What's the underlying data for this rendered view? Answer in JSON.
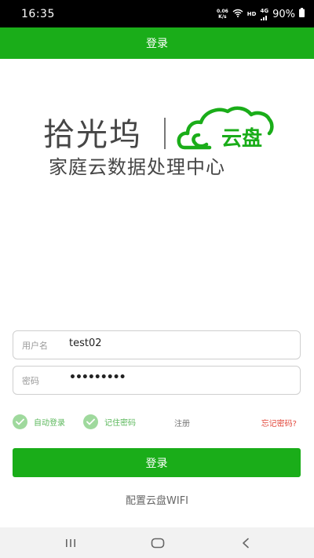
{
  "status_bar": {
    "time": "16:35",
    "speed_value": "0.06",
    "speed_unit": "K/s",
    "hd": "HD",
    "network": "4G",
    "battery": "90%"
  },
  "header": {
    "title": "登录"
  },
  "logo": {
    "brand": "拾光坞",
    "product": "云盘",
    "slogan": "家庭云数据处理中心"
  },
  "form": {
    "username_label": "用户名",
    "username_value": "test02",
    "password_label": "密码",
    "password_value": "•••••••••"
  },
  "options": {
    "auto_login": "自动登录",
    "auto_login_checked": true,
    "remember_password": "记住密码",
    "remember_password_checked": true,
    "register": "注册",
    "forgot_password": "忘记密码?"
  },
  "login_button": "登录",
  "wifi_link": "配置云盘WIFI",
  "colors": {
    "brand_green": "#1aad19",
    "check_green": "#9fd99d",
    "forgot_red": "#e2473b"
  },
  "icons": {
    "wifi": "wifi-icon",
    "battery": "battery-icon",
    "check": "check-icon",
    "recents": "recents-icon",
    "home": "home-icon",
    "back": "back-icon"
  }
}
